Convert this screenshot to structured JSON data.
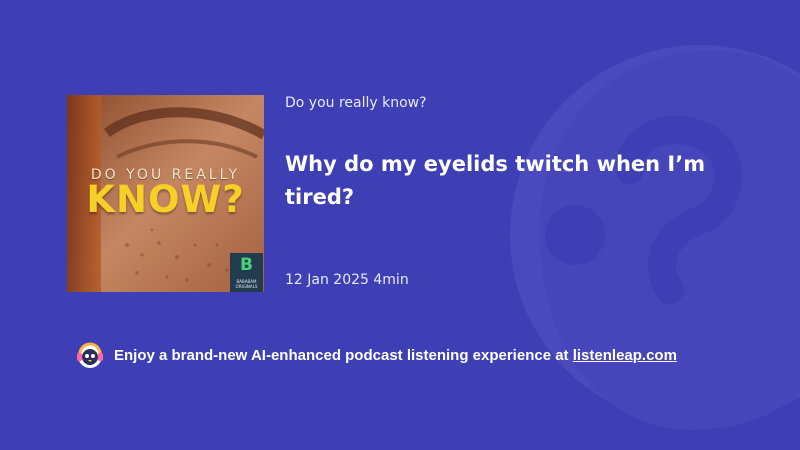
{
  "colors": {
    "background": "#3f3fb5",
    "accent": "#f6cf27",
    "text": "#ffffff"
  },
  "cover": {
    "icon": "podcast-cover-art",
    "title_top": "DO YOU REALLY",
    "title_main": "KNOW?",
    "badge_letter": "B",
    "badge_text_line1": "BABABAM",
    "badge_text_line2": "ORIGINALS"
  },
  "podcast": {
    "show_name": "Do you really know?",
    "episode_title": "Why do my eyelids twitch when I’m tired?",
    "date": "12 Jan 2025",
    "duration": "4min"
  },
  "promo": {
    "icon": "penguin-headphones-icon",
    "text": "Enjoy a brand-new AI-enhanced podcast listening experience at ",
    "link_text": "listenleap.com"
  }
}
